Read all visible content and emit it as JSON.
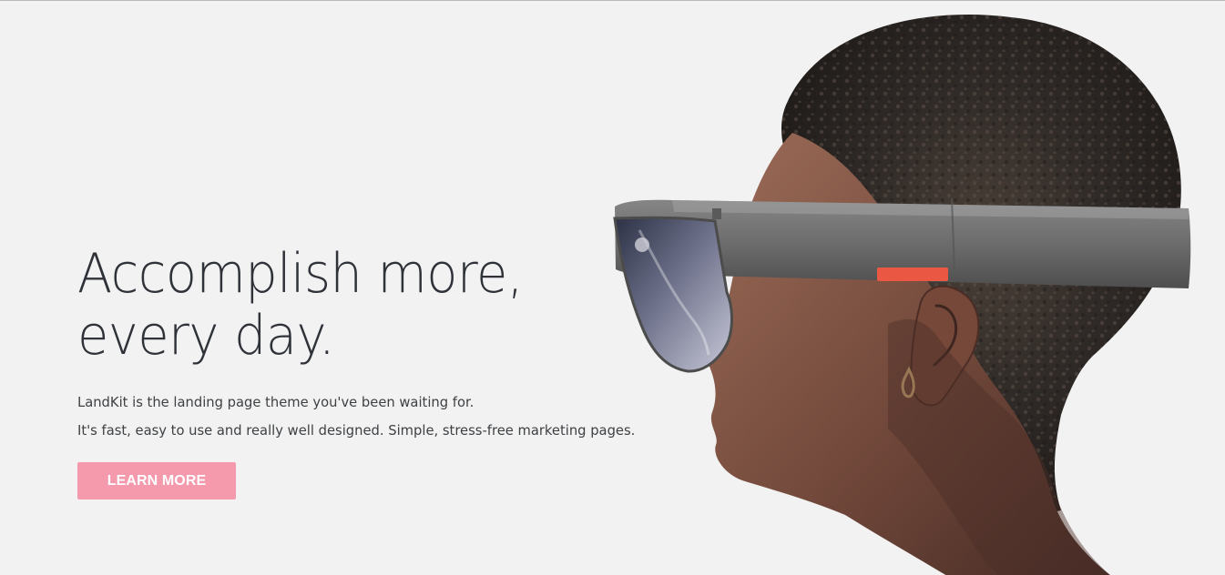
{
  "hero": {
    "headline_line1": "Accomplish more,",
    "headline_line2": "every day.",
    "description_line1": "LandKit is the landing page theme you've been waiting for.",
    "description_line2": "It's fast, easy to use and really well designed. Simple, stress-free marketing pages.",
    "cta_label": "LEARN MORE",
    "image_subject": "person-wearing-mixed-reality-headset"
  },
  "colors": {
    "background": "#f2f2f2",
    "headline": "#2f3339",
    "body_text": "#3e4144",
    "cta_background": "#f49aac",
    "cta_text": "#ffffff",
    "headset_accent": "#ea5844"
  }
}
